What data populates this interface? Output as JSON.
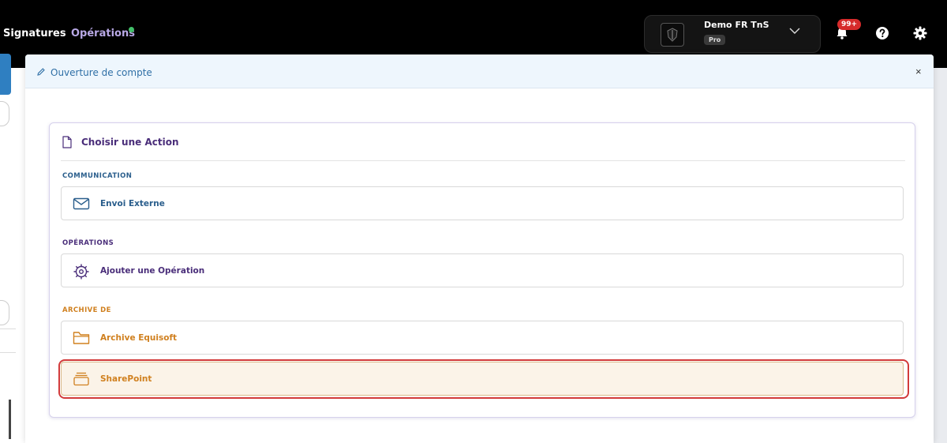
{
  "nav": {
    "signatures": "Signatures",
    "operations": "Opérations"
  },
  "account": {
    "name": "Demo FR TnS",
    "badge": "Pro"
  },
  "notifications": {
    "count": "99+"
  },
  "modal": {
    "title": "Ouverture de compte",
    "close": "×",
    "card_title": "Choisir une Action",
    "sections": [
      {
        "label": "COMMUNICATION",
        "color": "#2a5e8c",
        "actions": [
          {
            "label": "Envoi Externe",
            "icon": "envelope-icon",
            "color": "#2a5e8c"
          }
        ]
      },
      {
        "label": "OPÉRATIONS",
        "color": "#4a2e7a",
        "actions": [
          {
            "label": "Ajouter une Opération",
            "icon": "gear-outline-icon",
            "color": "#4a2e7a"
          }
        ]
      },
      {
        "label": "ARCHIVE DE",
        "color": "#d0801f",
        "actions": [
          {
            "label": "Archive Equisoft",
            "icon": "folder-icon",
            "color": "#d0801f"
          },
          {
            "label": "SharePoint",
            "icon": "folders-stack-icon",
            "color": "#d0801f",
            "selected": true
          }
        ]
      }
    ]
  },
  "colors": {
    "accent_purple": "#4a2e7a",
    "accent_blue": "#2a5e8c",
    "accent_orange": "#d0801f",
    "highlight_red": "#d23a3a"
  }
}
